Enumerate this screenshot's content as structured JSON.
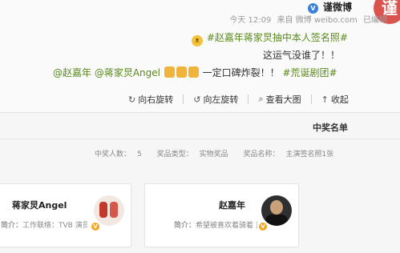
{
  "post": {
    "username": "谨微博",
    "meta": {
      "time": "今天 12:09",
      "source": "来自 微博 weibo.com",
      "status": "已编辑"
    },
    "line1_tag": "#赵嘉年蒋家炅抽中本人签名照#",
    "line2": "这运气没谁了！！",
    "line3_tag": "#荒诞剧团#",
    "line3_text": "一定口碑炸裂！！",
    "line3_mentions": "@赵嘉年 @蒋家炅Angel"
  },
  "actions": {
    "collapse": "收起",
    "view_large": "查看大图",
    "rotate_left": "向左旋转",
    "rotate_right": "向右旋转"
  },
  "winners": {
    "title": "中奖名单",
    "prize_name_label": "奖品名称：",
    "prize_name": "主演签名照1张",
    "prize_type_label": "奖品类型：",
    "prize_type": "实物奖品",
    "winner_count_label": "中奖人数：",
    "winner_count": "5",
    "cards": [
      {
        "name": "赵嘉年",
        "desc_label": "简介：",
        "desc": "希望被喜欢着骑着 直..."
      },
      {
        "name": "蒋家炅Angel",
        "desc_label": "简介：",
        "desc": "工作联络：TVB 演员..."
      }
    ]
  },
  "icons": {
    "verified": "verified-v-icon",
    "emoji": "dog-face-emoji-icon",
    "thumbs": "thumbs-up-icon",
    "badge": "yellow-v-badge-icon"
  },
  "colors": {
    "topic_green": "#5a8a1a",
    "verified_blue": "#3a7fd9",
    "badge_orange": "#f5a623"
  }
}
